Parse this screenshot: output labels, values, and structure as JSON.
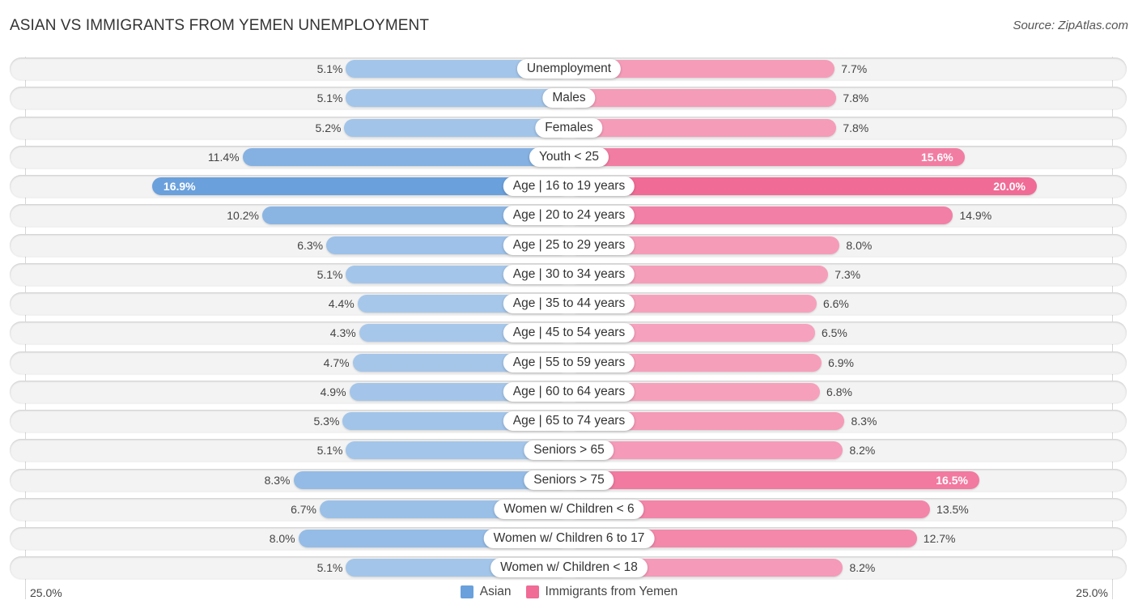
{
  "header": {
    "title": "ASIAN VS IMMIGRANTS FROM YEMEN UNEMPLOYMENT",
    "source": "Source: ZipAtlas.com"
  },
  "colors": {
    "asian_light": "#a8c8ea",
    "asian_strong": "#6aa0dc",
    "yemen_light": "#f6a3be",
    "yemen_strong": "#f06b96"
  },
  "chart_data": {
    "type": "bar",
    "orientation": "horizontal-diverging",
    "title": "ASIAN VS IMMIGRANTS FROM YEMEN UNEMPLOYMENT",
    "xlabel": "",
    "ylabel": "",
    "xlim": [
      -25.0,
      25.0
    ],
    "axis_labels": {
      "left": "25.0%",
      "right": "25.0%"
    },
    "legend_position": "bottom-center",
    "unit": "%",
    "categories": [
      "Unemployment",
      "Males",
      "Females",
      "Youth < 25",
      "Age | 16 to 19 years",
      "Age | 20 to 24 years",
      "Age | 25 to 29 years",
      "Age | 30 to 34 years",
      "Age | 35 to 44 years",
      "Age | 45 to 54 years",
      "Age | 55 to 59 years",
      "Age | 60 to 64 years",
      "Age | 65 to 74 years",
      "Seniors > 65",
      "Seniors > 75",
      "Women w/ Children < 6",
      "Women w/ Children 6 to 17",
      "Women w/ Children < 18"
    ],
    "series": [
      {
        "name": "Asian",
        "side": "left",
        "values": [
          5.1,
          5.1,
          5.2,
          11.4,
          16.9,
          10.2,
          6.3,
          5.1,
          4.4,
          4.3,
          4.7,
          4.9,
          5.3,
          5.1,
          8.3,
          6.7,
          8.0,
          5.1
        ],
        "labels": [
          "5.1%",
          "5.1%",
          "5.2%",
          "11.4%",
          "16.9%",
          "10.2%",
          "6.3%",
          "5.1%",
          "4.4%",
          "4.3%",
          "4.7%",
          "4.9%",
          "5.3%",
          "5.1%",
          "8.3%",
          "6.7%",
          "8.0%",
          "5.1%"
        ]
      },
      {
        "name": "Immigrants from Yemen",
        "side": "right",
        "values": [
          7.7,
          7.8,
          7.8,
          15.6,
          20.0,
          14.9,
          8.0,
          7.3,
          6.6,
          6.5,
          6.9,
          6.8,
          8.3,
          8.2,
          16.5,
          13.5,
          12.7,
          8.2
        ],
        "labels": [
          "7.7%",
          "7.8%",
          "7.8%",
          "15.6%",
          "20.0%",
          "14.9%",
          "8.0%",
          "7.3%",
          "6.6%",
          "6.5%",
          "6.9%",
          "6.8%",
          "8.3%",
          "8.2%",
          "16.5%",
          "13.5%",
          "12.7%",
          "8.2%"
        ]
      }
    ]
  },
  "legend": {
    "items": [
      {
        "label": "Asian",
        "color": "#6aa0dc"
      },
      {
        "label": "Immigrants from Yemen",
        "color": "#f06b96"
      }
    ]
  }
}
